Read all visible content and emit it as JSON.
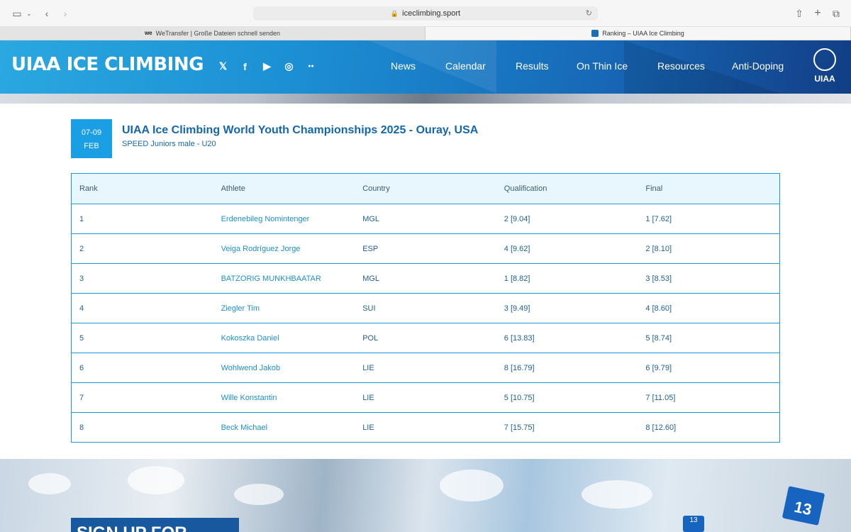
{
  "browser": {
    "url": "iceclimbing.sport",
    "tabs": [
      {
        "label": "WeTransfer | Große Dateien schnell senden",
        "favicon": "we"
      },
      {
        "label": "Ranking – UIAA Ice Climbing",
        "favicon": "uiaa"
      }
    ]
  },
  "header": {
    "logo": "UIAA ICE CLIMBING",
    "social": [
      {
        "glyph": "𝕏",
        "name": "x-icon"
      },
      {
        "glyph": "f",
        "name": "facebook-icon"
      },
      {
        "glyph": "▶",
        "name": "youtube-icon"
      },
      {
        "glyph": "◎",
        "name": "instagram-icon"
      },
      {
        "glyph": "●●",
        "name": "flickr-icon"
      }
    ],
    "nav": [
      "News",
      "Calendar",
      "Results",
      "On Thin Ice",
      "Resources",
      "Anti-Doping"
    ],
    "badge": "UIAA"
  },
  "event": {
    "date_days": "07-09",
    "date_month": "FEB",
    "title": "UIAA Ice Climbing World Youth Championships 2025 - Ouray, USA",
    "subtitle": "SPEED Juniors male - U20"
  },
  "table": {
    "headers": [
      "Rank",
      "Athlete",
      "Country",
      "Qualification",
      "Final"
    ],
    "rows": [
      [
        "1",
        "Erdenebileg Nomintenger",
        "MGL",
        "2 [9.04]",
        "1 [7.62]"
      ],
      [
        "2",
        "Veiga Rodríguez Jorge",
        "ESP",
        "4 [9.62]",
        "2 [8.10]"
      ],
      [
        "3",
        "BATZORIG MUNKHBAATAR",
        "MGL",
        "1 [8.82]",
        "3 [8.53]"
      ],
      [
        "4",
        "Ziegler Tim",
        "SUI",
        "3 [9.49]",
        "4 [8.60]"
      ],
      [
        "5",
        "Kokoszka Daniel",
        "POL",
        "6 [13.83]",
        "5 [8.74]"
      ],
      [
        "6",
        "Wohlwend Jakob",
        "LIE",
        "8 [16.79]",
        "6 [9.79]"
      ],
      [
        "7",
        "Wille Konstantin",
        "LIE",
        "5 [10.75]",
        "7 [11.05]"
      ],
      [
        "8",
        "Beck Michael",
        "LIE",
        "7 [15.75]",
        "8 [12.60]"
      ]
    ]
  },
  "footer": {
    "signup": "SIGN UP FOR",
    "bib_number": "13",
    "bib_small": "13"
  }
}
